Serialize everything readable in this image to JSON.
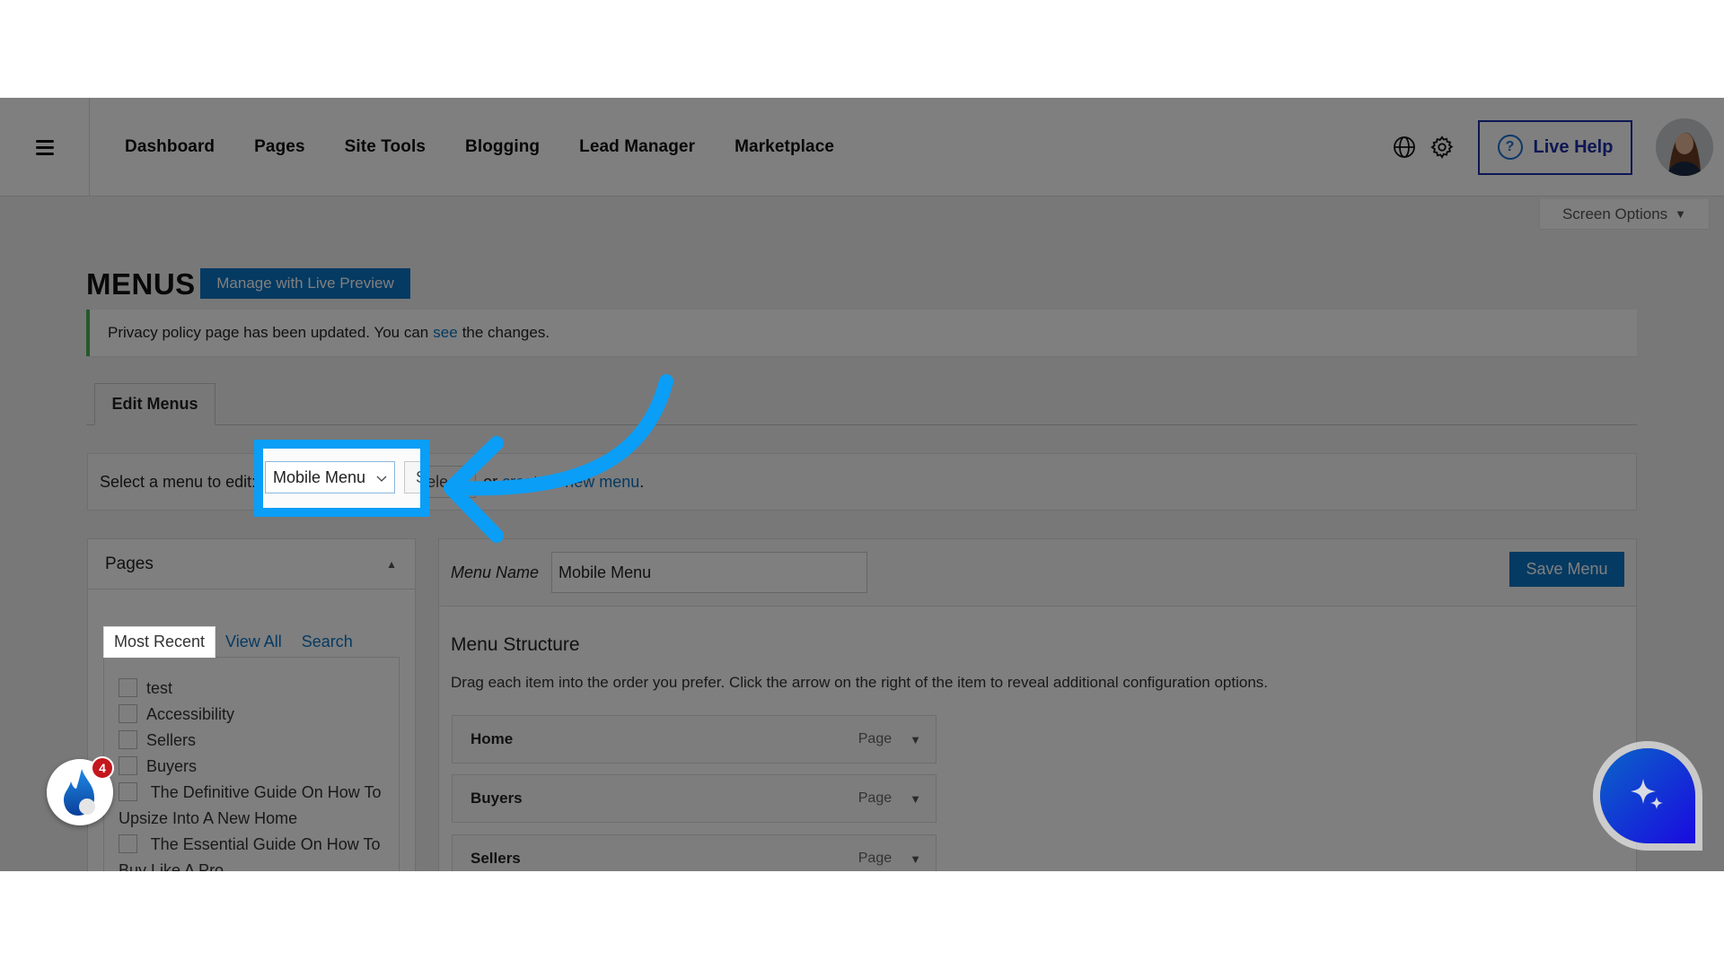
{
  "header": {
    "nav": [
      "Dashboard",
      "Pages",
      "Site Tools",
      "Blogging",
      "Lead Manager",
      "Marketplace"
    ],
    "live_help_label": "Live Help",
    "icons": [
      "menu-icon",
      "globe-icon",
      "gear-icon",
      "question-icon"
    ]
  },
  "screen_options": {
    "label": "Screen Options",
    "icon": "▼"
  },
  "page": {
    "title": "MENUS",
    "manage_button": "Manage with Live Preview"
  },
  "notice": {
    "text_before": "Privacy policy page has been updated. You can",
    "link": "see",
    "text_after": "the changes.",
    "accent_color": "#46b450"
  },
  "tabs": {
    "edit_menus": "Edit Menus"
  },
  "select_row": {
    "label": "Select a menu to edit:",
    "selected_menu": "Mobile Menu",
    "select_button": "Select",
    "create_prefix": "or",
    "create_link": "create a new menu",
    "create_suffix": "."
  },
  "pages_panel": {
    "title": "Pages",
    "tabs": [
      "Most Recent",
      "View All",
      "Search"
    ],
    "active_tab": "Most Recent",
    "items": [
      "test",
      "Accessibility",
      "Sellers",
      "Buyers",
      "The Definitive Guide On How To Upsize Into A New Home",
      "The Essential Guide On How To Buy Like A Pro"
    ]
  },
  "menu_editor": {
    "menu_name_label": "Menu Name",
    "menu_name_value": "Mobile Menu",
    "save_button": "Save Menu",
    "structure_title": "Menu Structure",
    "structure_desc": "Drag each item into the order you prefer. Click the arrow on the right of the item to reveal additional configuration options.",
    "items": [
      {
        "title": "Home",
        "type": "Page"
      },
      {
        "title": "Buyers",
        "type": "Page"
      },
      {
        "title": "Sellers",
        "type": "Page"
      }
    ]
  },
  "widgets": {
    "notification_count": "4",
    "highlight_color": "#0a9ef7",
    "brand_blue": "#0a74c4"
  }
}
